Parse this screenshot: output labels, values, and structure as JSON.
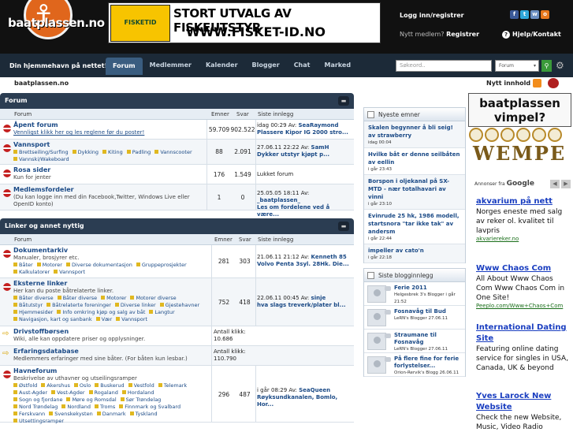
{
  "header": {
    "logo_text": "baatplassen.no",
    "banner_line1": "STORT UTVALG AV FISKEUTSTYR",
    "banner_line2": "WWW.FISKET-ID.NO",
    "banner_logo": "FISKETID",
    "login_label": "Logg inn/registrer",
    "not_member": "Nytt medlem?",
    "register": "Registrer",
    "help": "Hjelp/Kontakt"
  },
  "nav": {
    "tagline": "Din hjemmehavn på nettet!",
    "items": [
      "Forum",
      "Medlemmer",
      "Kalender",
      "Blogger",
      "Chat",
      "Marked"
    ],
    "search_placeholder": "Søkeord..",
    "search_scope": "Forum"
  },
  "crumb": {
    "home": "baatplassen.no",
    "new_content": "Nytt innhold"
  },
  "forum": {
    "title": "Forum",
    "cols": {
      "forum": "Forum",
      "topics": "Emner",
      "posts": "Svar",
      "last": "Siste innlegg"
    },
    "rows": [
      {
        "title": "Åpent forum",
        "desc": "Vennligst klikk her og les reglene før du poster!",
        "topics": "59.709",
        "posts": "902.522",
        "last_time": "idag 00:29 Av:",
        "last_user": "SeaRaymond",
        "last_title": "Plassere Kipor IG 2000 stro..."
      },
      {
        "title": "Vannsport",
        "subs": [
          "Brettseiling/Surfing",
          "Dykking",
          "Kiting",
          "Padling",
          "Vannscooter",
          "Vannski/Wakeboard"
        ],
        "topics": "88",
        "posts": "2.091",
        "last_time": "27.06.11 22:22 Av:",
        "last_user": "SamH",
        "last_title": "Dykker utstyr kjøpt p..."
      },
      {
        "title": "Rosa sider",
        "desc": "Kun for jenter",
        "topics": "176",
        "posts": "1.549",
        "last_plain": "Lukket forum"
      },
      {
        "title": "Medlemsfordeler",
        "desc": "(Du kan logge inn med din Facebook,Twitter, Windows Live eller OpenID konto)",
        "topics": "1",
        "posts": "0",
        "last_time": "25.05.05 18:11 Av:",
        "last_user": "_baatplassen_",
        "last_title": "Les om fordelene ved å være..."
      }
    ]
  },
  "links": {
    "title": "Linker og annet nyttig",
    "cols": {
      "forum": "Forum",
      "topics": "Emner",
      "posts": "Svar",
      "last": "Siste innlegg"
    },
    "rows": [
      {
        "title": "Dokumentarkiv",
        "desc": "Manualer, brosjyrer etc.",
        "subs": [
          "Båter",
          "Motorer",
          "Diverse dokumentasjon",
          "Gruppeprosjekter",
          "Kalkulatorer",
          "Vannsport"
        ],
        "topics": "281",
        "posts": "303",
        "last_time": "21.06.11 21:12 Av:",
        "last_user": "Kenneth 85",
        "last_title": "Volvo Penta 3syl. 28Hk. Die..."
      },
      {
        "title": "Eksterne linker",
        "desc": "Her kan du poste båtrelaterte linker.",
        "subs": [
          "Båter diverse",
          "Båter diverse",
          "Motorer",
          "Motorer diverse",
          "Båtutstyr",
          "Båtrelaterte foreninger",
          "Diverse linker",
          "Gjestehavner",
          "Hjemmesider",
          "Info omkring kjøp og salg av båt",
          "Langtur",
          "Navigasjon, kart og sanbank",
          "Vær",
          "Vannsport"
        ],
        "topics": "752",
        "posts": "418",
        "last_time": "22.06.11 00:45 Av:",
        "last_user": "sinje",
        "last_title": "hva slags treverk/plater bl..."
      },
      {
        "title": "Drivstoffbørsen",
        "desc": "Wiki, alle kan oppdatere priser og opplysninger.",
        "clicks_label": "Antall klikk:",
        "clicks": "10.686"
      },
      {
        "title": "Erfaringsdatabase",
        "desc": "Medlemmers erfaringer med sine båter. (For båten kun lesbar.)",
        "clicks_label": "Antall klikk:",
        "clicks": "110.790"
      },
      {
        "title": "Havneforum",
        "desc": "Beskrivelse av uthavner og utseilingsramper",
        "subs": [
          "Østfold",
          "Akershus",
          "Oslo",
          "Buskerud",
          "Vestfold",
          "Telemark",
          "Aust-Agder",
          "Vest-Agder",
          "Rogaland",
          "Hordaland",
          "Sogn og fjordane",
          "Møre og Romsdal",
          "Sør Trøndelag",
          "Nord Trøndelag",
          "Nordland",
          "Troms",
          "Finnmark og Svalbard",
          "Ferskvann",
          "Svenskekysten",
          "Danmark",
          "Tyskland",
          "Utsettingsramper"
        ],
        "topics": "296",
        "posts": "487",
        "last_time": "i går 08:29 Av:",
        "last_user": "SeaQueen",
        "last_title": "Røyksundkanalen, Bomlo, Hor..."
      }
    ]
  },
  "news": {
    "title": "Nyeste emner",
    "items": [
      {
        "t": "Skalen begynner å bli seig! av strawberry",
        "d": "idag 00:04"
      },
      {
        "t": "Hvilke båt er denne seilbåten av eellin",
        "d": "i går 23:43"
      },
      {
        "t": "Borspon i oljekanal på SX-MTD - nær totalhavari av vinni",
        "d": "i går 23:10"
      },
      {
        "t": "Evinrude 25 hk, 1986 modell, startsnora \"tar ikke tak\" av andersm",
        "d": "i går 22:44"
      },
      {
        "t": "impeller av cato'n",
        "d": "i går 22:18"
      }
    ]
  },
  "blogs": {
    "title": "Siste blogginnlegg",
    "items": [
      {
        "t": "Ferie 2011",
        "who": "Helgesbrek 3's Blogger i går 21:52"
      },
      {
        "t": "Fosnavåg til Bud",
        "who": "LeRN's Blogger 27.06.11"
      },
      {
        "t": "Straumane til Fosnavåg",
        "who": "LeRN's Blogger 27.06.11"
      },
      {
        "t": "På flere fine for ferie forlystelser...",
        "who": "Orion-Rervik's Blogg 26.06.11"
      }
    ]
  },
  "ads": {
    "vimpel_line1": "baatplassen",
    "vimpel_line2": "vimpel?",
    "wempe": "WEMPE",
    "ads_by": "Annonser fra",
    "google": "Google",
    "items": [
      {
        "h": "akvarium på nett",
        "b": "Norges eneste med salg av reker ol. kvalitet til lavpris",
        "u": "akvariereker.no"
      },
      {
        "h": "Www Chaos Com",
        "b": "All About Www Chaos Com Www Chaos Com in One Site!",
        "u": "Peeplo.com/Www+Chaos+Com"
      },
      {
        "h": "International Dating Site",
        "b": "Featuring online dating service for singles in USA, Canada, UK & beyond",
        "u": ""
      },
      {
        "h": "Yves Larock New Website",
        "b": "Check the new Website, Music, Video Radio",
        "u": ""
      }
    ]
  }
}
